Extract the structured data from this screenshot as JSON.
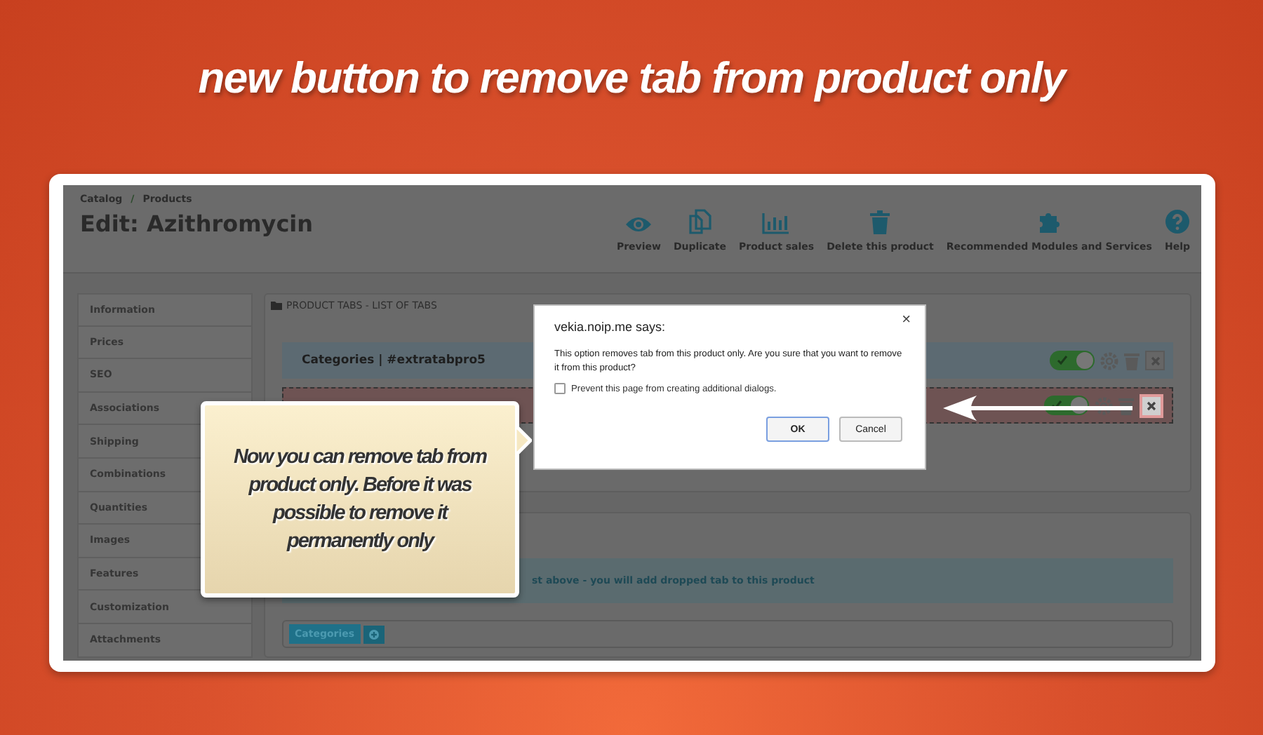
{
  "headline": "new button to remove tab from product only",
  "breadcrumb": [
    "Catalog",
    "Products"
  ],
  "breadcrumb_separator": "/",
  "page_title": "Edit: Azithromycin",
  "toolbar": [
    {
      "label": "Preview",
      "kind": "eye"
    },
    {
      "label": "Duplicate",
      "kind": "copy"
    },
    {
      "label": "Product sales",
      "kind": "chart"
    },
    {
      "label": "Delete this product",
      "kind": "trash"
    },
    {
      "label": "Recommended Modules and Services",
      "kind": "puzzle"
    },
    {
      "label": "Help",
      "kind": "help"
    }
  ],
  "sidebar": [
    "Information",
    "Prices",
    "SEO",
    "Associations",
    "Shipping",
    "Combinations",
    "Quantities",
    "Images",
    "Features",
    "Customization",
    "Attachments"
  ],
  "tabs_panel": {
    "heading": "PRODUCT TABS - LIST OF TABS",
    "rows": [
      {
        "label": "Categories | #extratabpro5",
        "enabled": true,
        "highlighted": false
      },
      {
        "enabled": true,
        "highlighted": true
      }
    ]
  },
  "add_panel": {
    "hint": "st above - you will add dropped tab to this product",
    "chips": [
      "Categories"
    ]
  },
  "dialog": {
    "title": "vekia.noip.me says:",
    "close": "×",
    "message": "This option removes tab from this product only. Are you sure that you want to remove it from this product?",
    "checkbox": {
      "label": "Prevent this page from creating additional dialogs.",
      "checked": false
    },
    "buttons": [
      {
        "label": "OK",
        "selected": true
      },
      {
        "label": "Cancel",
        "selected": false
      }
    ]
  },
  "callout": {
    "text": "Now you can remove tab from product only. Before it was possible to remove it permanently only"
  }
}
